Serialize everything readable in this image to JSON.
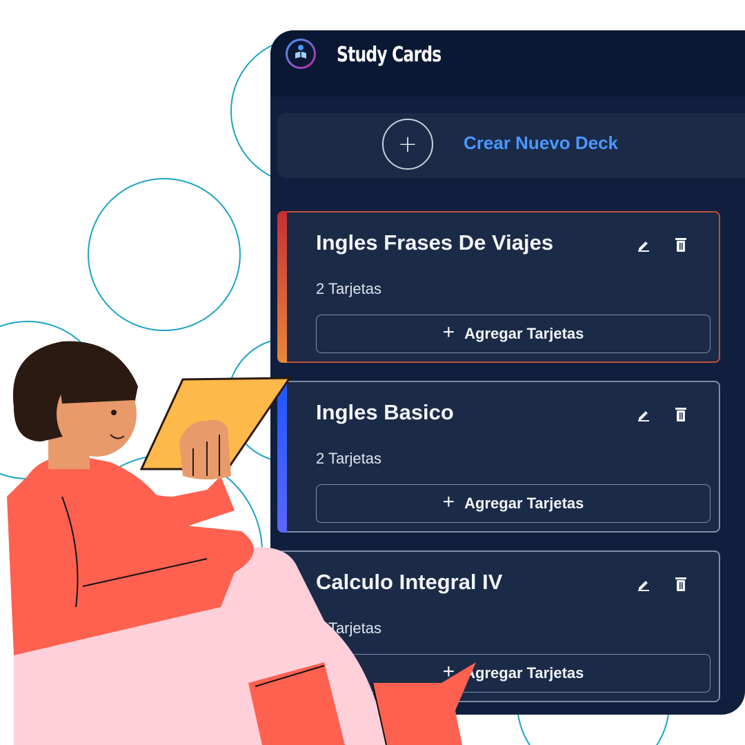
{
  "app": {
    "title": "Study Cards",
    "logo_icon": "reading-person-icon"
  },
  "new_deck": {
    "label": "Crear Nuevo Deck",
    "icon": "plus-icon"
  },
  "decks": [
    {
      "title": "Ingles Frases De Viajes",
      "count": "2 Tarjetas",
      "add_label": "Agregar Tarjetas",
      "accent": [
        "#c62f33",
        "#e8883a"
      ]
    },
    {
      "title": "Ingles Basico",
      "count": "2 Tarjetas",
      "add_label": "Agregar Tarjetas",
      "accent": [
        "#1f56ff",
        "#5b66ff"
      ]
    },
    {
      "title": "Calculo Integral IV",
      "count": "3 Tarjetas",
      "add_label": "Agregar Tarjetas",
      "accent": [
        "#1a2a47",
        "#1a2a47"
      ]
    }
  ],
  "colors": {
    "panel_bg": "#0f1f3d",
    "card_bg": "#1a2a47",
    "link_blue": "#4a98ff",
    "circle_outline": "#1aa3c4"
  }
}
